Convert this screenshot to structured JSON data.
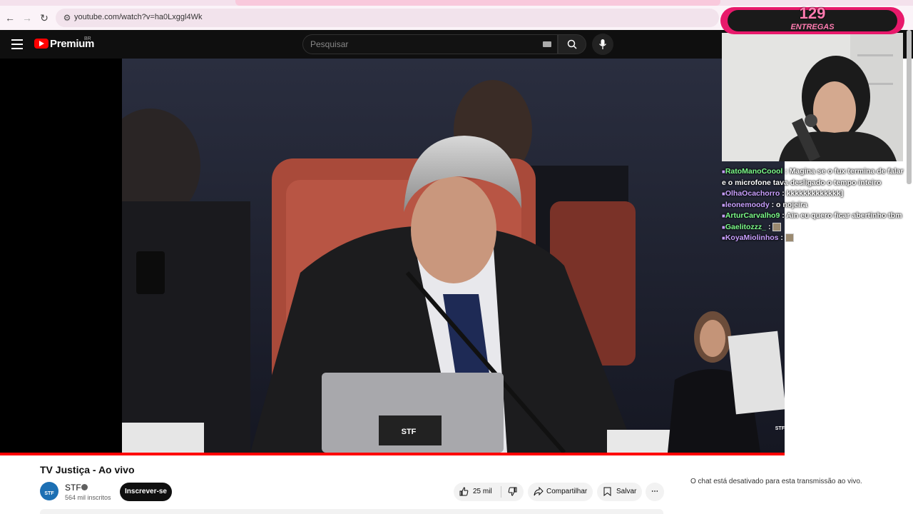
{
  "browser": {
    "url": "youtube.com/watch?v=ha0Lxggl4Wk",
    "back_icon": "arrow-left-icon",
    "forward_icon": "arrow-right-icon",
    "reload_icon": "reload-icon"
  },
  "header": {
    "brand": "Premium",
    "country": "BR",
    "search_placeholder": "Pesquisar"
  },
  "video": {
    "watermark": "STF",
    "laptop_label": "STF",
    "progress": 1.0
  },
  "overlay": {
    "count": "129",
    "label": "ENTREGAS"
  },
  "chat": [
    {
      "user": "RatoManoCoool",
      "user_color": "#7CFC8A",
      "text": "Magina se o fux termina de falar e o microfone tava desligado o tempo inteiro"
    },
    {
      "user": "OlhaOcachorro",
      "user_color": "#C9A0FF",
      "text": "kkkkkkkkkkkkk]"
    },
    {
      "user": "leonemoody",
      "user_color": "#C9A0FF",
      "text": "o nojeira"
    },
    {
      "user": "ArturCarvalho9",
      "user_color": "#7CFC8A",
      "text": "Ain eu quero ficar abertinho tbm"
    },
    {
      "user": "Gaelitozzz_",
      "user_color": "#7CFC8A",
      "text": ""
    },
    {
      "user": "KoyaMiolinhos",
      "user_color": "#C9A0FF",
      "text": ""
    }
  ],
  "below": {
    "title": "TV Justiça - Ao vivo",
    "channel": "STF",
    "subscribers": "564 mil inscritos",
    "subscribe_label": "Inscrever-se",
    "likes": "25 mil",
    "share_label": "Compartilhar",
    "save_label": "Salvar",
    "chat_disabled": "O chat está desativado para esta transmissão ao vivo."
  }
}
